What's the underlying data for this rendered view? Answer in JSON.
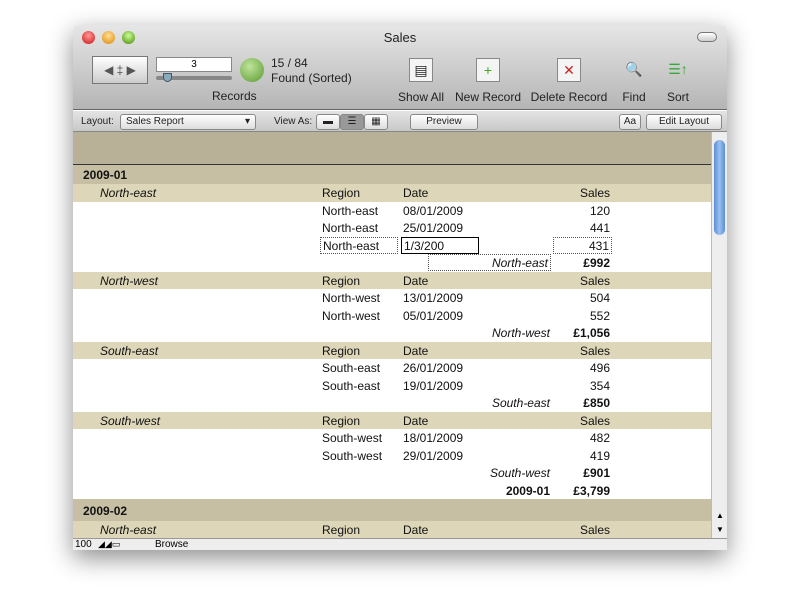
{
  "window": {
    "title": "Sales"
  },
  "toolbar": {
    "record_number": "3",
    "record_count": "15 / 84",
    "found_status": "Found (Sorted)",
    "records_label": "Records",
    "buttons": [
      {
        "label": "Show All",
        "icon": "show-all-icon"
      },
      {
        "label": "New Record",
        "icon": "new-record-icon"
      },
      {
        "label": "Delete Record",
        "icon": "delete-record-icon"
      },
      {
        "label": "Find",
        "icon": "magnifier-icon"
      },
      {
        "label": "Sort",
        "icon": "sort-icon"
      }
    ]
  },
  "layoutbar": {
    "layout_label": "Layout:",
    "layout_value": "Sales Report",
    "view_as_label": "View As:",
    "preview": "Preview",
    "text_format": "Aa",
    "edit_layout": "Edit Layout"
  },
  "columns": {
    "region": "Region",
    "date": "Date",
    "sales": "Sales"
  },
  "groups": [
    {
      "month": "2009-01",
      "total_label": "2009-01",
      "total": "£3,799",
      "regions": [
        {
          "name": "North-east",
          "records": [
            [
              "North-east",
              "08/01/2009",
              "120"
            ],
            [
              "North-east",
              "25/01/2009",
              "441"
            ],
            [
              "North-east",
              "1/3/200",
              "431"
            ]
          ],
          "summary_label": "North-east",
          "summary": "£992"
        },
        {
          "name": "North-west",
          "records": [
            [
              "North-west",
              "13/01/2009",
              "504"
            ],
            [
              "North-west",
              "05/01/2009",
              "552"
            ]
          ],
          "summary_label": "North-west",
          "summary": "£1,056"
        },
        {
          "name": "South-east",
          "records": [
            [
              "South-east",
              "26/01/2009",
              "496"
            ],
            [
              "South-east",
              "19/01/2009",
              "354"
            ]
          ],
          "summary_label": "South-east",
          "summary": "£850"
        },
        {
          "name": "South-west",
          "records": [
            [
              "South-west",
              "18/01/2009",
              "482"
            ],
            [
              "South-west",
              "29/01/2009",
              "419"
            ]
          ],
          "summary_label": "South-west",
          "summary": "£901"
        }
      ]
    },
    {
      "month": "2009-02",
      "regions": [
        {
          "name": "North-east"
        }
      ]
    }
  ],
  "status": {
    "zoom": "100",
    "mode": "Browse"
  },
  "colors": {
    "group_band": "#c6bfa3",
    "subgroup_band": "#ddd6b8",
    "header_band": "#b8b198"
  }
}
